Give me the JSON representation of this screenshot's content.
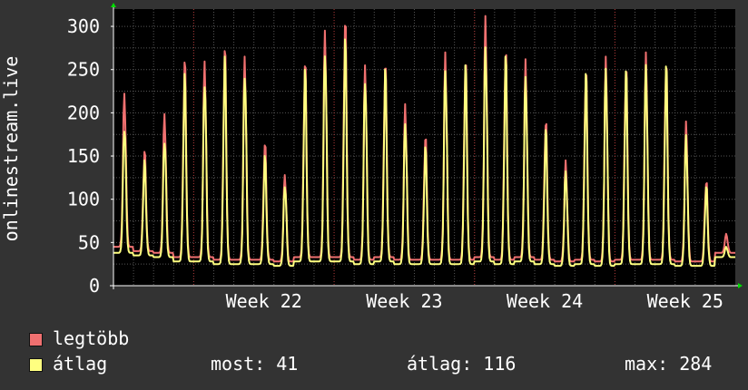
{
  "chart_data": {
    "type": "line",
    "ylabel": "onlinestream.live",
    "xlabel": "",
    "ylim": [
      0,
      320
    ],
    "yticks": [
      0,
      50,
      100,
      150,
      200,
      250,
      300
    ],
    "x_tick_labels": [
      "Week 22",
      "Week 23",
      "Week 24",
      "Week 25"
    ],
    "grid": true,
    "x_days": 31,
    "series": [
      {
        "name": "legtöbb",
        "color": "#f07070",
        "daily_peaks": [
          225,
          155,
          200,
          260,
          260,
          275,
          265,
          165,
          128,
          260,
          295,
          310,
          255,
          260,
          210,
          175,
          270,
          265,
          312,
          278,
          262,
          195,
          145,
          255,
          265,
          260,
          270,
          265,
          190,
          125,
          60
        ],
        "daily_troughs": [
          45,
          40,
          38,
          33,
          33,
          30,
          30,
          30,
          28,
          33,
          33,
          33,
          30,
          33,
          30,
          30,
          30,
          30,
          33,
          30,
          33,
          30,
          28,
          30,
          28,
          30,
          30,
          30,
          28,
          28,
          38
        ]
      },
      {
        "name": "átlag",
        "color": "#ffff80",
        "daily_peaks": [
          190,
          145,
          175,
          245,
          245,
          265,
          255,
          150,
          120,
          250,
          280,
          285,
          245,
          250,
          195,
          160,
          258,
          255,
          285,
          265,
          248,
          180,
          135,
          245,
          255,
          248,
          258,
          255,
          175,
          115,
          45
        ],
        "daily_troughs": [
          38,
          35,
          33,
          28,
          28,
          25,
          25,
          25,
          23,
          28,
          28,
          28,
          25,
          28,
          25,
          25,
          25,
          25,
          28,
          25,
          28,
          25,
          23,
          25,
          23,
          25,
          25,
          25,
          23,
          23,
          33
        ]
      }
    ]
  },
  "legend": {
    "max_label": "legtöbb",
    "avg_label": "átlag",
    "max_color": "#f07070",
    "avg_color": "#ffff80",
    "stats": {
      "now": "most: 41",
      "avg": "átlag: 116",
      "max": "max: 284"
    }
  }
}
